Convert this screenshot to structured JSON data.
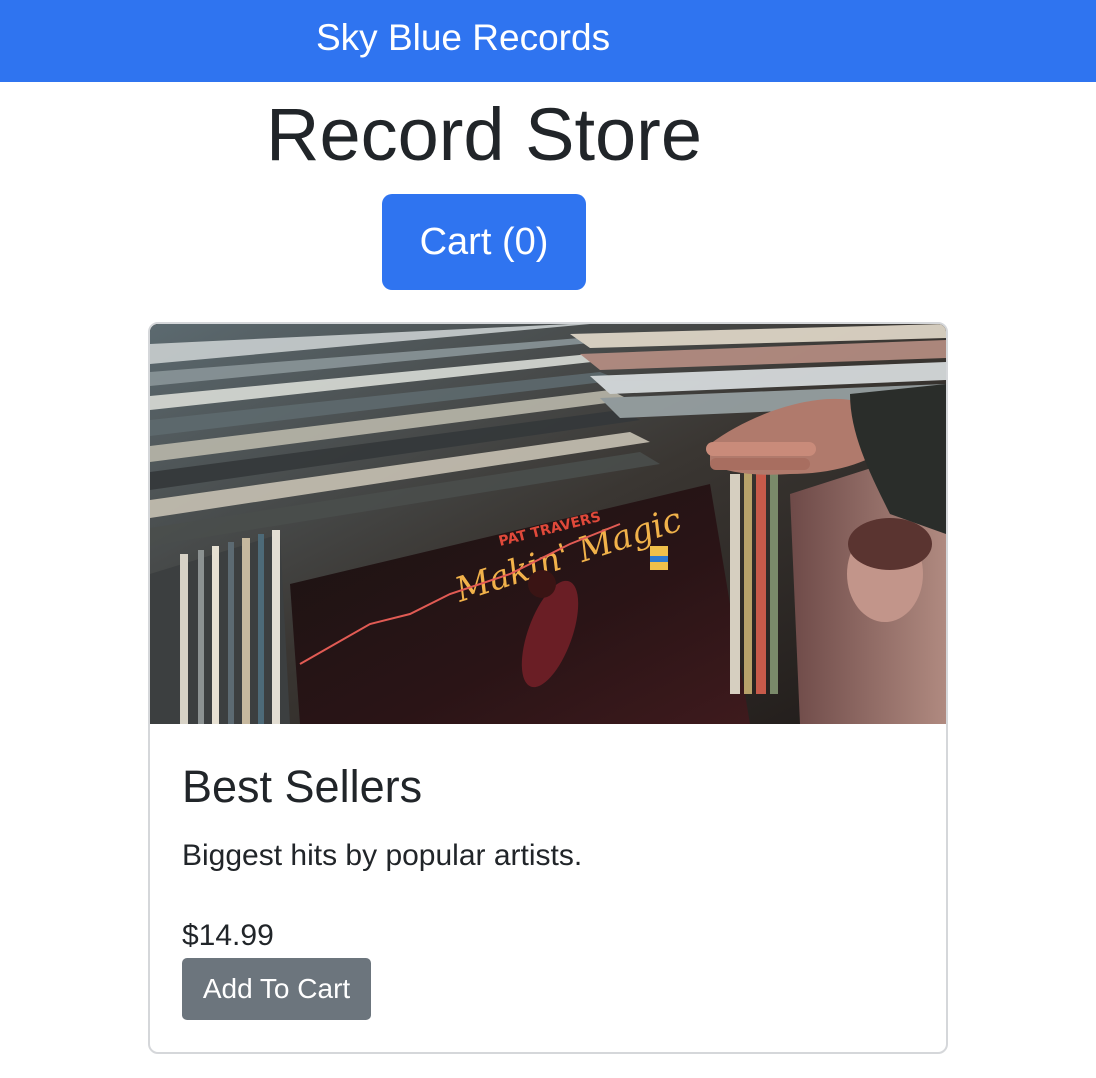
{
  "navbar": {
    "brand": "Sky Blue Records",
    "background_color": "#2f74f0"
  },
  "header": {
    "title": "Record Store"
  },
  "cart": {
    "label": "Cart (0)",
    "count": 0,
    "button_color": "#2f74f0"
  },
  "product": {
    "image_alt": "vinyl-records-crate-photo",
    "image_text": {
      "artist": "PAT TRAVERS",
      "album": "Makin' Magic"
    },
    "title": "Best Sellers",
    "description": "Biggest hits by popular artists.",
    "price": "$14.99",
    "add_label": "Add To Cart",
    "add_button_color": "#6c757d"
  }
}
